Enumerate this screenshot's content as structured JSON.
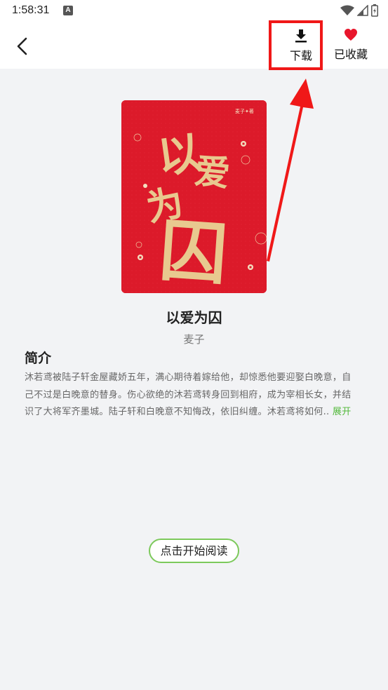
{
  "status_bar": {
    "time": "1:58:31",
    "notification_icon": "A"
  },
  "header": {
    "back_icon": "chevron-left-icon",
    "download_label": "下载",
    "collect_label": "已收藏"
  },
  "book": {
    "title": "以爱为囚",
    "author": "麦子",
    "cover_author_mark": "麦子✦著",
    "cover_calligraphy": [
      "以",
      "爱",
      "为",
      "囚"
    ]
  },
  "intro": {
    "heading": "简介",
    "text": "沐若鸢被陆子轩金屋藏娇五年，满心期待着嫁给他，却惊悉他要迎娶白晚意，自己不过是白晚意的替身。伤心欲绝的沐若鸢转身回到相府，成为宰相长女，并结识了大将军齐墨城。陆子轩和白晚意不知悔改，依旧纠缠。沐若鸢将如何..",
    "expand_label": "展开"
  },
  "read_button_label": "点击开始阅读",
  "colors": {
    "accent_green": "#52b83a",
    "highlight_red": "#f01818",
    "cover_red": "#dc1a2a",
    "gold": "#e8c98f"
  }
}
